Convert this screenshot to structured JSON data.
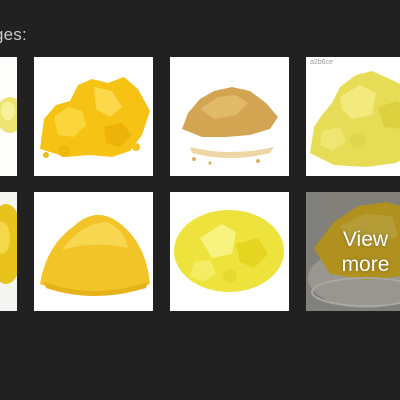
{
  "section": {
    "label": "ges:"
  },
  "thumbnails": [
    {
      "name": "thumb-r1-c0",
      "icon": "yellow-powder-image",
      "tone": "#efe56a"
    },
    {
      "name": "thumb-r1-c1",
      "icon": "yellow-powder-image",
      "tone": "#f7c51a"
    },
    {
      "name": "thumb-r1-c2",
      "icon": "tan-powder-image",
      "tone": "#d2a54e"
    },
    {
      "name": "thumb-r1-c3",
      "icon": "yellow-powder-image",
      "tone": "#e5db55",
      "watermark": "a2b6ce"
    },
    {
      "name": "thumb-r2-c0",
      "icon": "yellow-powder-image",
      "tone": "#e9c21c"
    },
    {
      "name": "thumb-r2-c1",
      "icon": "yellow-powder-image",
      "tone": "#f2c427"
    },
    {
      "name": "thumb-r2-c2",
      "icon": "yellow-powder-image",
      "tone": "#efe43d"
    },
    {
      "name": "thumb-r2-c3",
      "icon": "yellow-powder-image",
      "tone": "#f3c300"
    }
  ],
  "view_more": {
    "line1": "View",
    "line2": "more"
  }
}
